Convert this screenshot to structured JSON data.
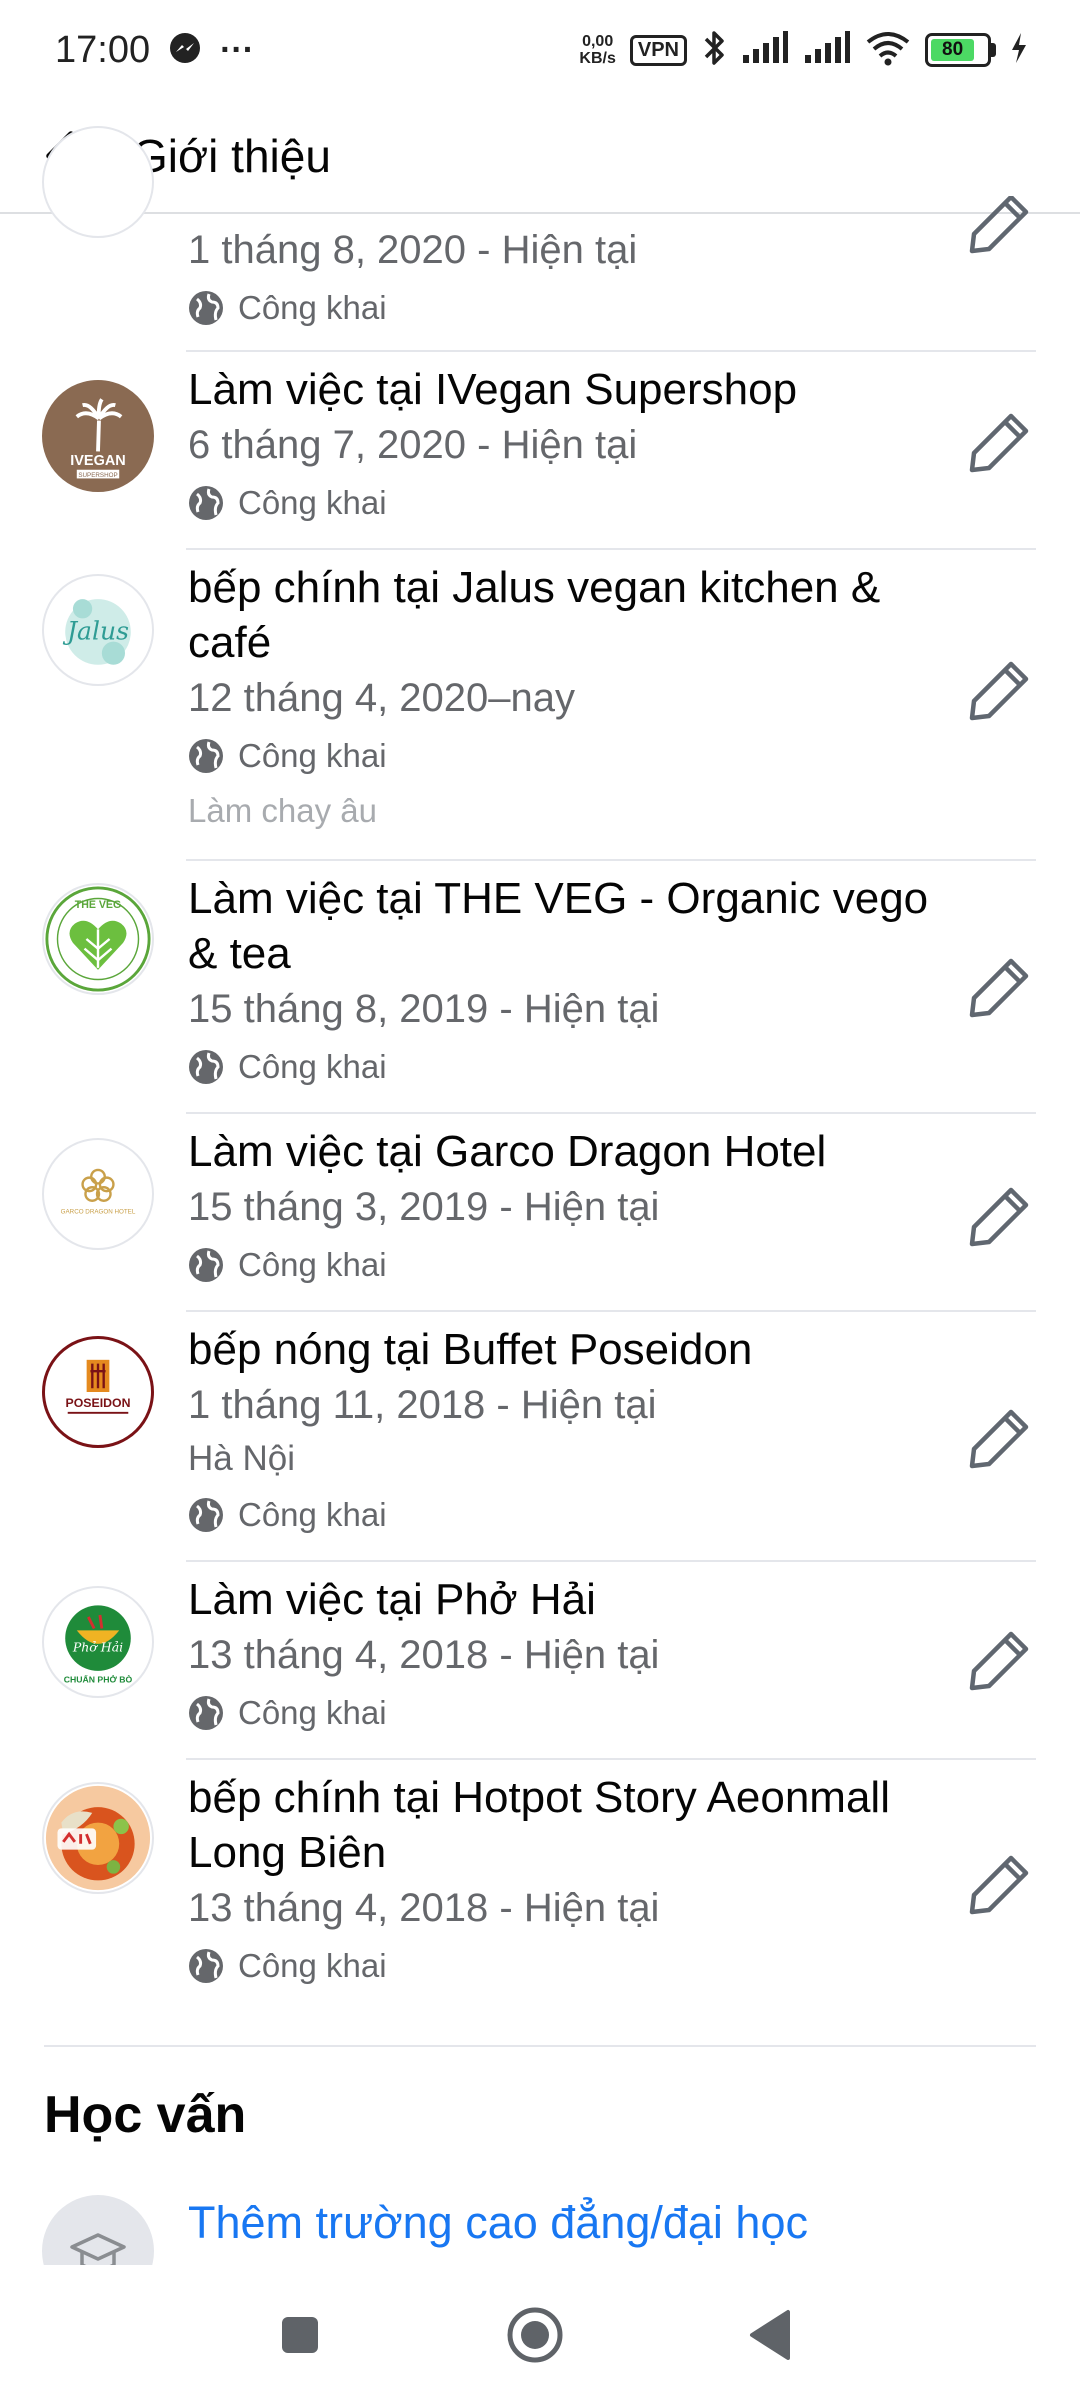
{
  "status_bar": {
    "time": "17:00",
    "overflow": "···",
    "net_speed_value": "0,00",
    "net_speed_unit": "KB/s",
    "vpn": "VPN",
    "battery_level": "80",
    "icons": [
      "messenger-icon",
      "bluetooth-icon",
      "signal-icon",
      "wifi-icon",
      "battery-icon",
      "charging-icon"
    ]
  },
  "header": {
    "title": "Giới thiệu"
  },
  "entries": [
    {
      "title": "",
      "date": "1 tháng 8, 2020 - Hiện tại",
      "location": "",
      "privacy": "Công khai",
      "note": "",
      "logo": "partial-logo"
    },
    {
      "title": "Làm việc tại IVegan Supershop",
      "date": "6 tháng 7, 2020 - Hiện tại",
      "location": "",
      "privacy": "Công khai",
      "note": "",
      "logo": "ivegan-logo",
      "logo_text": "IVEGAN",
      "logo_subtext": "SUPERSHOP"
    },
    {
      "title": "bếp chính tại Jalus vegan kitchen & café",
      "date": "12 tháng 4, 2020–nay",
      "location": "",
      "privacy": "Công khai",
      "note": "Làm chay âu",
      "logo": "jalus-logo",
      "logo_text": "Jalus"
    },
    {
      "title": "Làm việc tại THE VEG - Organic vego & tea",
      "date": "15 tháng 8, 2019 - Hiện tại",
      "location": "",
      "privacy": "Công khai",
      "note": "",
      "logo": "theveg-logo",
      "logo_text": "THE VEG"
    },
    {
      "title": "Làm việc tại Garco Dragon Hotel",
      "date": "15 tháng 3, 2019 - Hiện tại",
      "location": "",
      "privacy": "Công khai",
      "note": "",
      "logo": "garco-logo",
      "logo_text": "GARCO DRAGON HOTEL"
    },
    {
      "title": "bếp nóng tại Buffet Poseidon",
      "date": "1 tháng 11, 2018 - Hiện tại",
      "location": "Hà Nội",
      "privacy": "Công khai",
      "note": "",
      "logo": "poseidon-logo",
      "logo_text": "POSEIDON"
    },
    {
      "title": "Làm việc tại Phở Hải",
      "date": "13 tháng 4, 2018 - Hiện tại",
      "location": "",
      "privacy": "Công khai",
      "note": "",
      "logo": "phohai-logo",
      "logo_text": "Phở Hải",
      "logo_subtext": "CHUẨN PHỞ BÒ"
    },
    {
      "title": "bếp chính tại Hotpot Story Aeonmall Long Biên",
      "date": "13 tháng 4, 2018 - Hiện tại",
      "location": "",
      "privacy": "Công khai",
      "note": "",
      "logo": "hotpot-logo"
    }
  ],
  "education": {
    "title": "Học vấn",
    "add_label": "Thêm trường cao đẳng/đại học"
  },
  "colors": {
    "link": "#1877f2",
    "secondary_text": "#65676b",
    "battery": "#4cd964"
  }
}
